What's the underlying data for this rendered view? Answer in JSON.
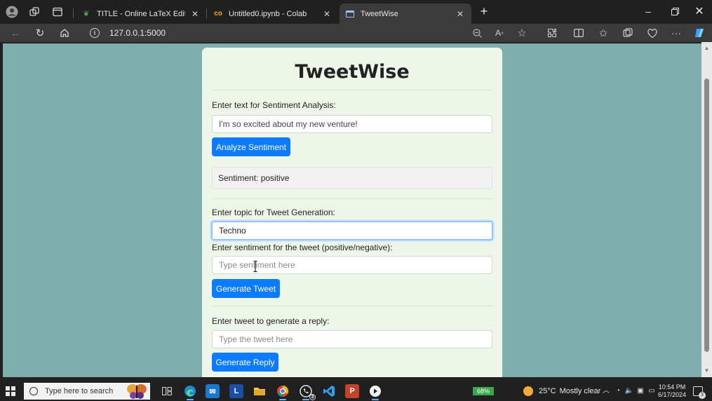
{
  "browser": {
    "tabs": [
      {
        "title": "TITLE - Online LaTeX Editor Overl",
        "icon": "overleaf-icon",
        "active": false
      },
      {
        "title": "Untitled0.ipynb - Colab",
        "icon": "colab-icon",
        "active": false
      },
      {
        "title": "TweetWise",
        "icon": "page-icon",
        "active": true
      }
    ],
    "new_tab": "+",
    "address": "127.0.0.1:5000"
  },
  "app": {
    "title": "TweetWise",
    "sentiment_section": {
      "label": "Enter text for Sentiment Analysis:",
      "input_value": "I'm so excited about my new venture!",
      "button": "Analyze Sentiment",
      "result": "Sentiment: positive"
    },
    "tweet_section": {
      "topic_label": "Enter topic for Tweet Generation:",
      "topic_value": "Techno",
      "sentiment_label": "Enter sentiment for the tweet (positive/negative):",
      "sentiment_placeholder": "Type sentiment here",
      "button": "Generate Tweet"
    },
    "reply_section": {
      "label": "Enter tweet to generate a reply:",
      "placeholder": "Type the tweet here",
      "button": "Generate Reply"
    }
  },
  "taskbar": {
    "search_placeholder": "Type here to search",
    "battery": "68%",
    "weather_temp": "25°C",
    "weather_text": "Mostly clear",
    "time": "10:54 PM",
    "date": "6/17/2024",
    "notification_count": "3",
    "whatsapp_badge": "3"
  },
  "colors": {
    "page_bg": "#7fafac",
    "card_bg": "#eef6ea",
    "button": "#0d7bff"
  }
}
